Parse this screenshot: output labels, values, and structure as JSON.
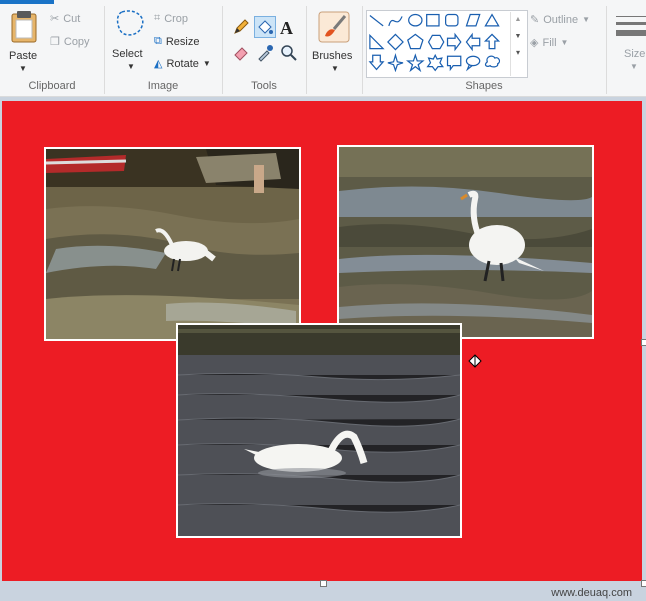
{
  "clipboard": {
    "paste": "Paste",
    "cut": "Cut",
    "copy": "Copy",
    "group": "Clipboard"
  },
  "image": {
    "select": "Select",
    "crop": "Crop",
    "resize": "Resize",
    "rotate": "Rotate",
    "group": "Image"
  },
  "tools": {
    "group": "Tools"
  },
  "brushes": {
    "label": "Brushes"
  },
  "shapes": {
    "group": "Shapes",
    "outline": "Outline",
    "fill": "Fill"
  },
  "size": {
    "label": "Size"
  },
  "colors": {
    "canvas": "#ed1c24",
    "accent": "#1a73c7"
  },
  "watermark": "www.deuaq.com"
}
